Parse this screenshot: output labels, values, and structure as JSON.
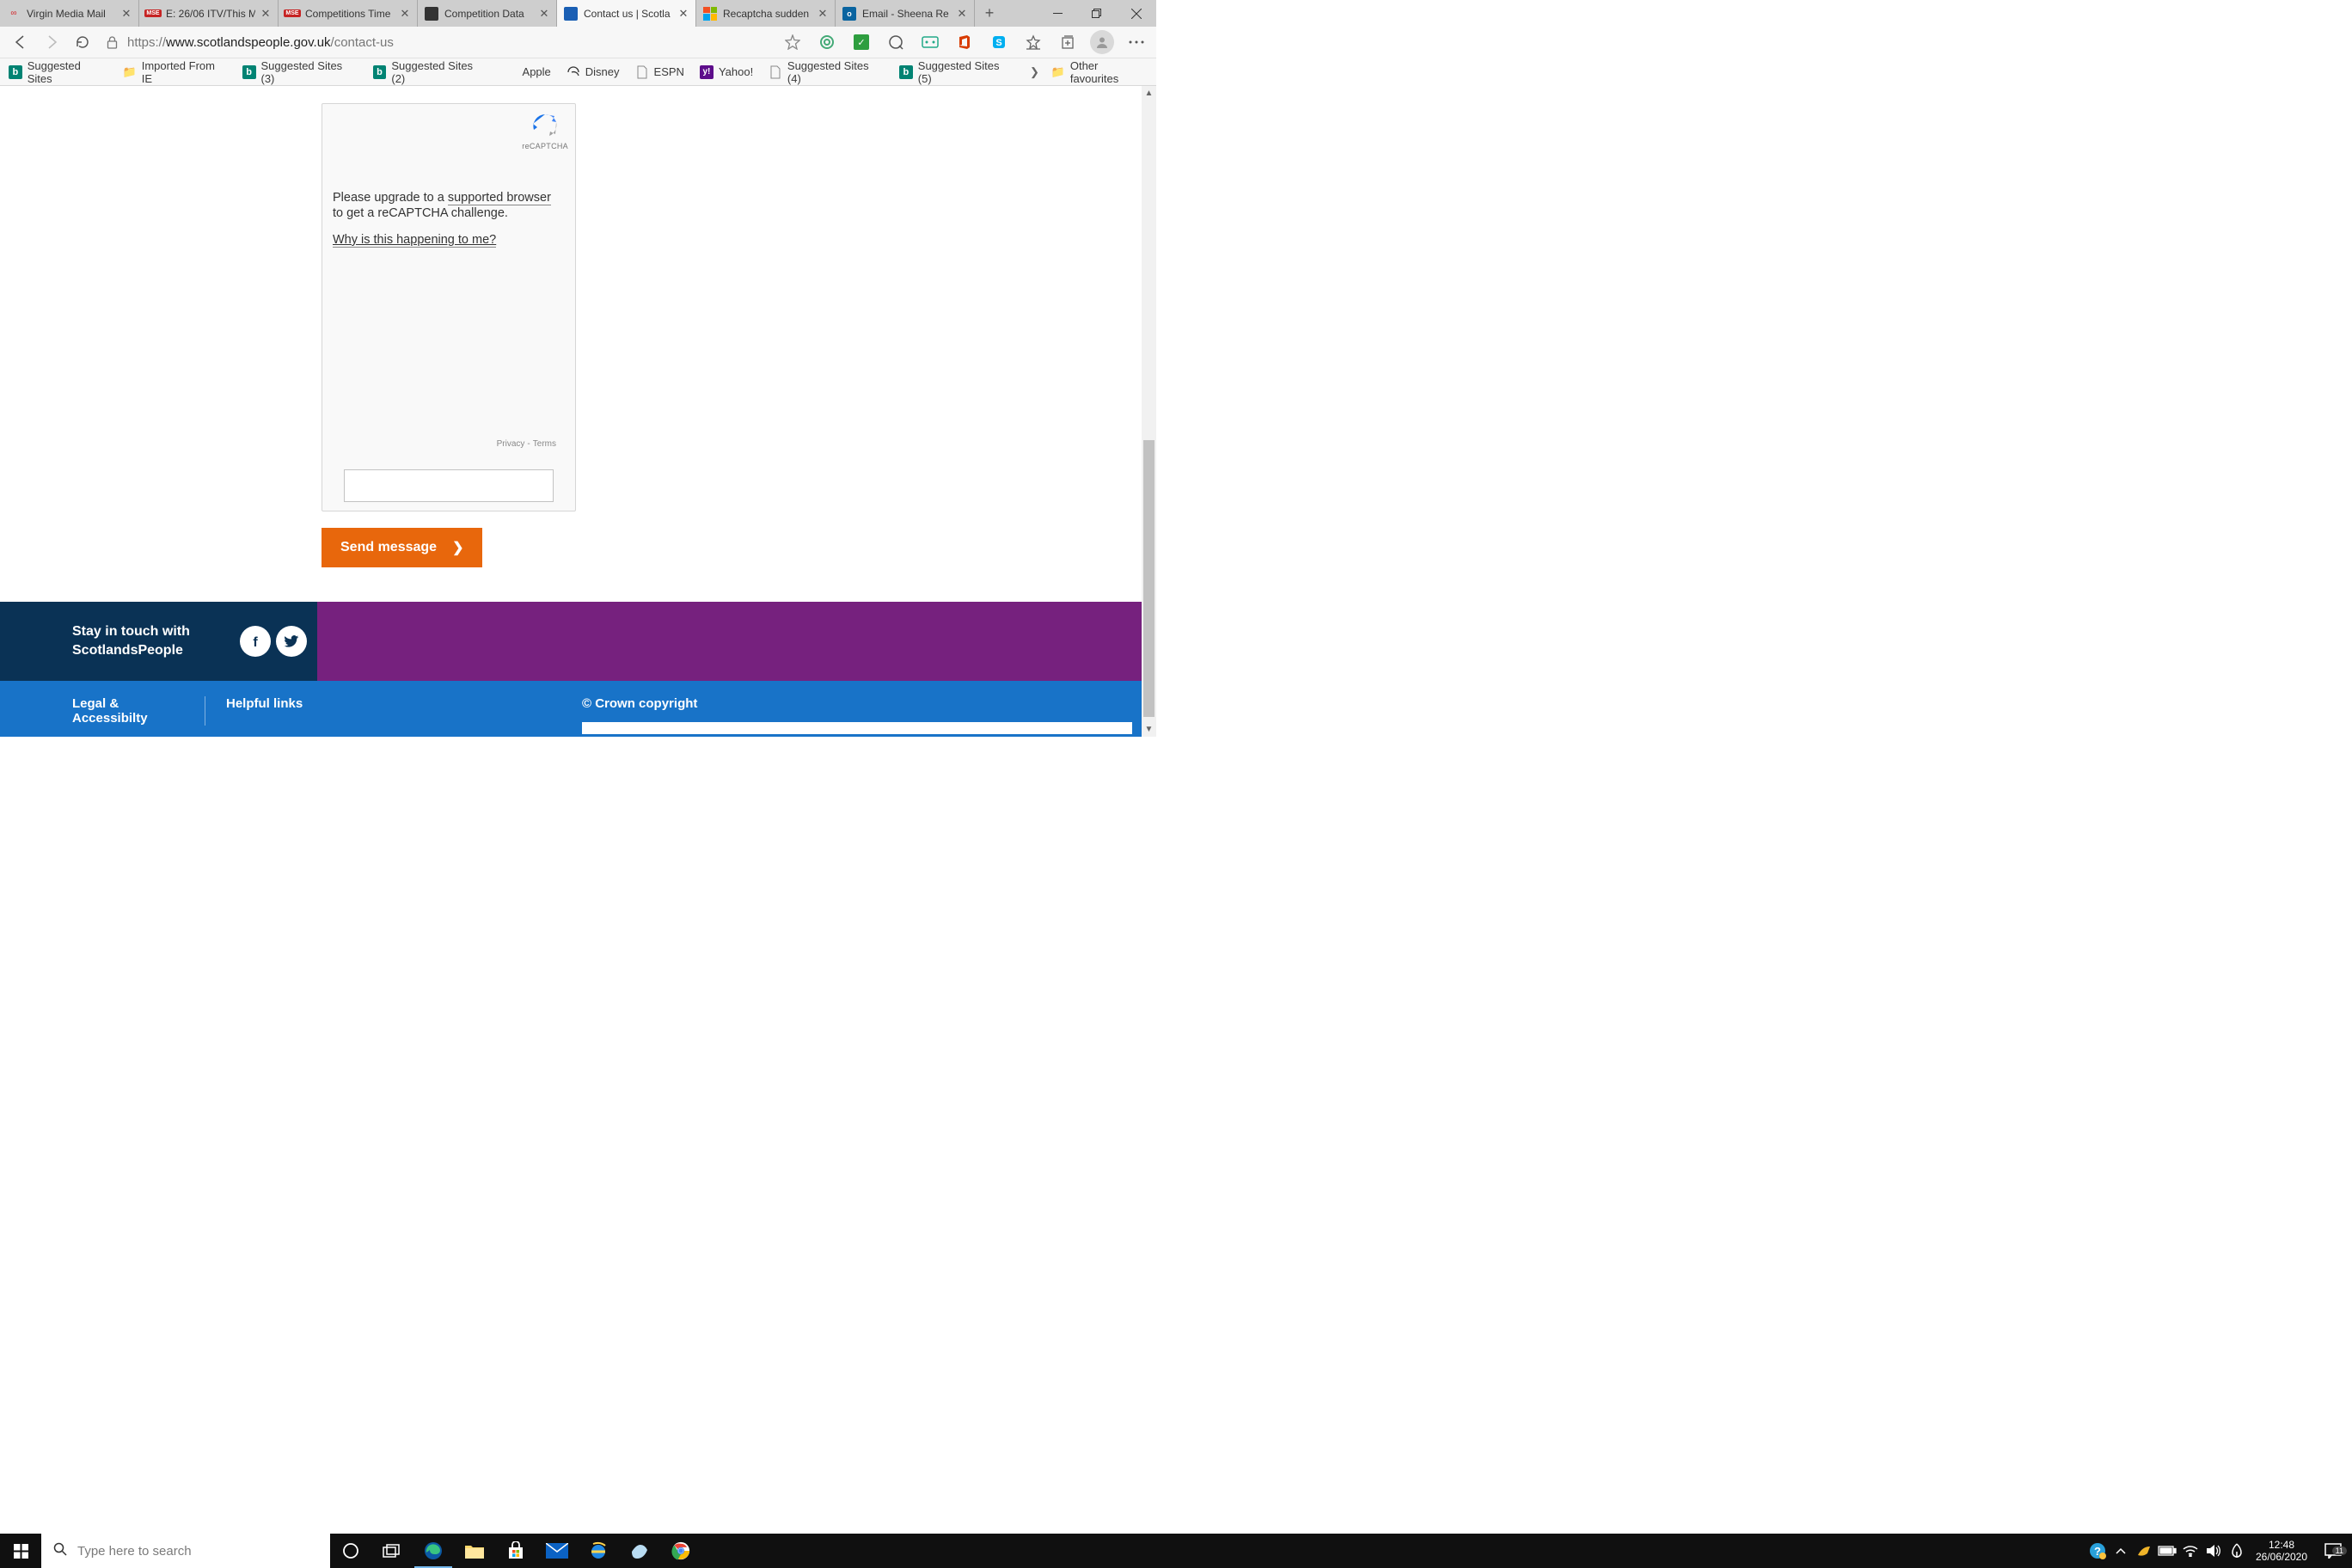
{
  "window": {
    "minimize": "−",
    "maximize": "❐",
    "close": "✕"
  },
  "tabs": [
    {
      "title": "Virgin Media Mail",
      "favicon": "virgin"
    },
    {
      "title": "E: 26/06 ITV/This M",
      "favicon": "mse"
    },
    {
      "title": "Competitions Time",
      "favicon": "mse"
    },
    {
      "title": "Competition Data",
      "favicon": "dark"
    },
    {
      "title": "Contact us | Scotla",
      "favicon": "blue",
      "active": true
    },
    {
      "title": "Recaptcha sudden",
      "favicon": "ms"
    },
    {
      "title": "Email - Sheena Re",
      "favicon": "outlook"
    }
  ],
  "address": {
    "scheme": "https://",
    "host": "www.scotlandspeople.gov.uk",
    "path": "/contact-us"
  },
  "bookmarks": [
    {
      "label": "Suggested Sites",
      "icon": "bing"
    },
    {
      "label": "Imported From IE",
      "icon": "folder"
    },
    {
      "label": "Suggested Sites (3)",
      "icon": "bing"
    },
    {
      "label": "Suggested Sites (2)",
      "icon": "bing"
    },
    {
      "label": "Apple",
      "icon": "apple"
    },
    {
      "label": "Disney",
      "icon": "disney"
    },
    {
      "label": "ESPN",
      "icon": "file"
    },
    {
      "label": "Yahoo!",
      "icon": "yahoo"
    },
    {
      "label": "Suggested Sites (4)",
      "icon": "file"
    },
    {
      "label": "Suggested Sites (5)",
      "icon": "bing"
    }
  ],
  "other_favourites": "Other favourites",
  "recaptcha": {
    "brand": "reCAPTCHA",
    "msg_pre": "Please upgrade to a ",
    "msg_link": "supported browser",
    "msg_post": " to get a reCAPTCHA challenge.",
    "why": "Why is this happening to me?",
    "privacy": "Privacy",
    "terms": "Terms"
  },
  "send_button": "Send message",
  "footer": {
    "stay_line1": "Stay in touch with",
    "stay_line2": "ScotlandsPeople",
    "legal": "Legal & Accessibilty",
    "helpful": "Helpful links",
    "copyright": "© Crown copyright"
  },
  "taskbar": {
    "search_placeholder": "Type here to search",
    "time": "12:48",
    "date": "26/06/2020",
    "notif_count": "11"
  }
}
